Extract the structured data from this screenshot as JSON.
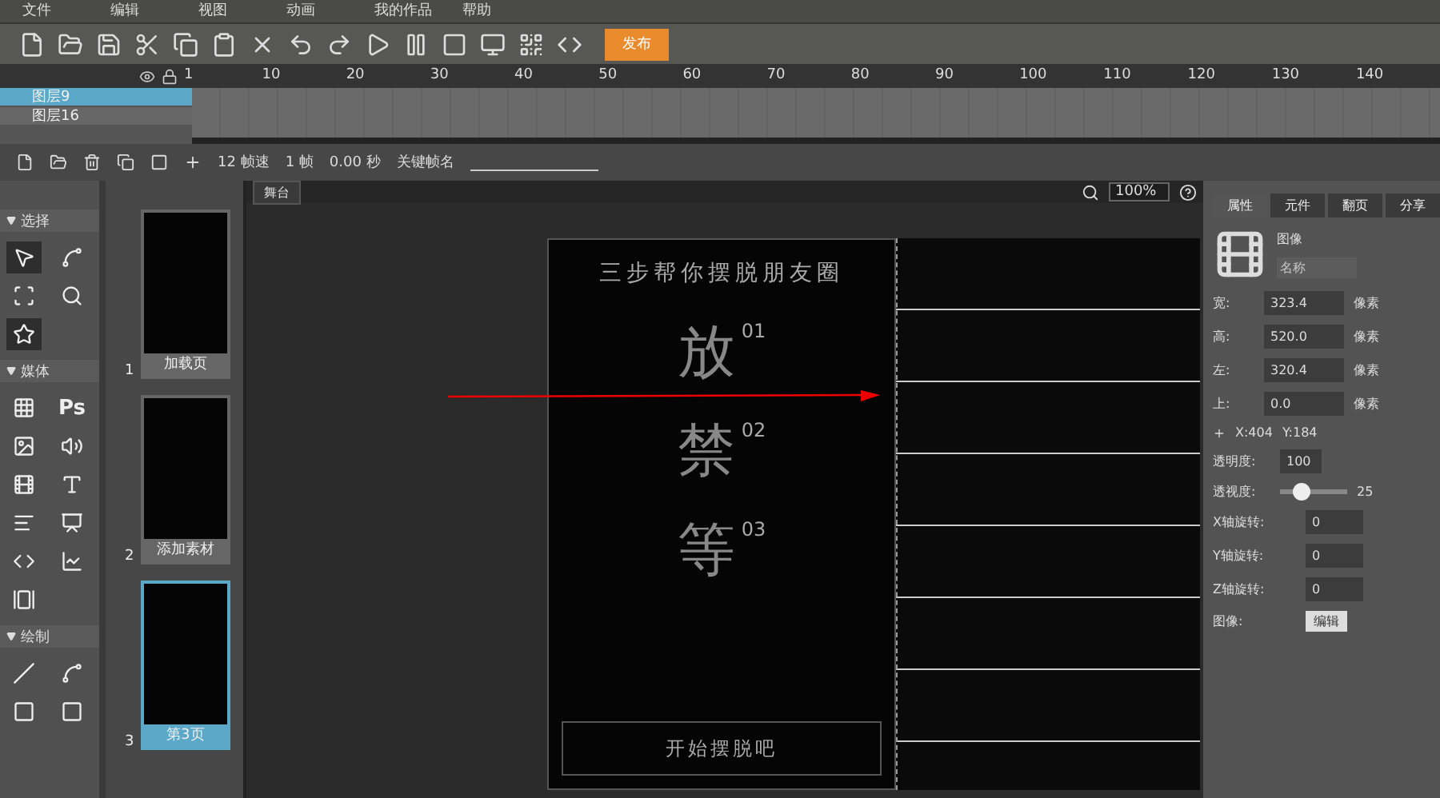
{
  "menu": [
    "文件",
    "编辑",
    "视图",
    "动画",
    "我的作品",
    "帮助"
  ],
  "publish": "发布",
  "ruler": [
    "1",
    "10",
    "20",
    "30",
    "40",
    "50",
    "60",
    "70",
    "80",
    "90",
    "100",
    "110",
    "120",
    "130",
    "140"
  ],
  "layers": [
    {
      "name": "图层9",
      "selected": true
    },
    {
      "name": "图层16",
      "selected": false
    }
  ],
  "timeline_bar": {
    "fps": "12 帧速",
    "frame": "1 帧",
    "time": "0.00 秒",
    "keyframe_label": "关键帧名"
  },
  "tool_sections": [
    {
      "title": "选择",
      "expanded": true,
      "kind": "select"
    },
    {
      "title": "媒体",
      "expanded": true,
      "kind": "media",
      "ps_tool": "Ps"
    },
    {
      "title": "绘制",
      "expanded": true,
      "kind": "draw"
    }
  ],
  "pages": [
    {
      "number": "1",
      "label": "加载页",
      "selected": false
    },
    {
      "number": "2",
      "label": "添加素材",
      "selected": false
    },
    {
      "number": "3",
      "label": "第3页",
      "selected": true
    }
  ],
  "stage": {
    "tab": "舞台",
    "zoom": "100%",
    "design": {
      "title": "三步帮你摆脱朋友圈",
      "steps": [
        {
          "glyph": "放",
          "number": "01"
        },
        {
          "glyph": "禁",
          "number": "02"
        },
        {
          "glyph": "等",
          "number": "03"
        }
      ],
      "button": "开始摆脱吧"
    }
  },
  "props": {
    "tabs": [
      {
        "label": "属性",
        "selected": true
      },
      {
        "label": "元件",
        "selected": false
      },
      {
        "label": "翻页",
        "selected": false
      },
      {
        "label": "分享",
        "selected": false
      }
    ],
    "type": "图像",
    "name_placeholder": "名称",
    "dims": [
      {
        "label": "宽:",
        "value": "323.4",
        "unit": "像素"
      },
      {
        "label": "高:",
        "value": "520.0",
        "unit": "像素"
      },
      {
        "label": "左:",
        "value": "320.4",
        "unit": "像素"
      },
      {
        "label": "上:",
        "value": "0.0",
        "unit": "像素"
      }
    ],
    "x": "X:404",
    "y": "Y:184",
    "opacity": {
      "label": "透明度:",
      "value": "100"
    },
    "perspective": {
      "label": "透视度:",
      "level": 0.3,
      "reading": "25"
    },
    "rotations": [
      {
        "label": "X轴旋转:",
        "value": "0"
      },
      {
        "label": "Y轴旋转:",
        "value": "0"
      },
      {
        "label": "Z轴旋转:",
        "value": "0"
      }
    ],
    "image_label": "图像:",
    "edit": "编辑"
  }
}
